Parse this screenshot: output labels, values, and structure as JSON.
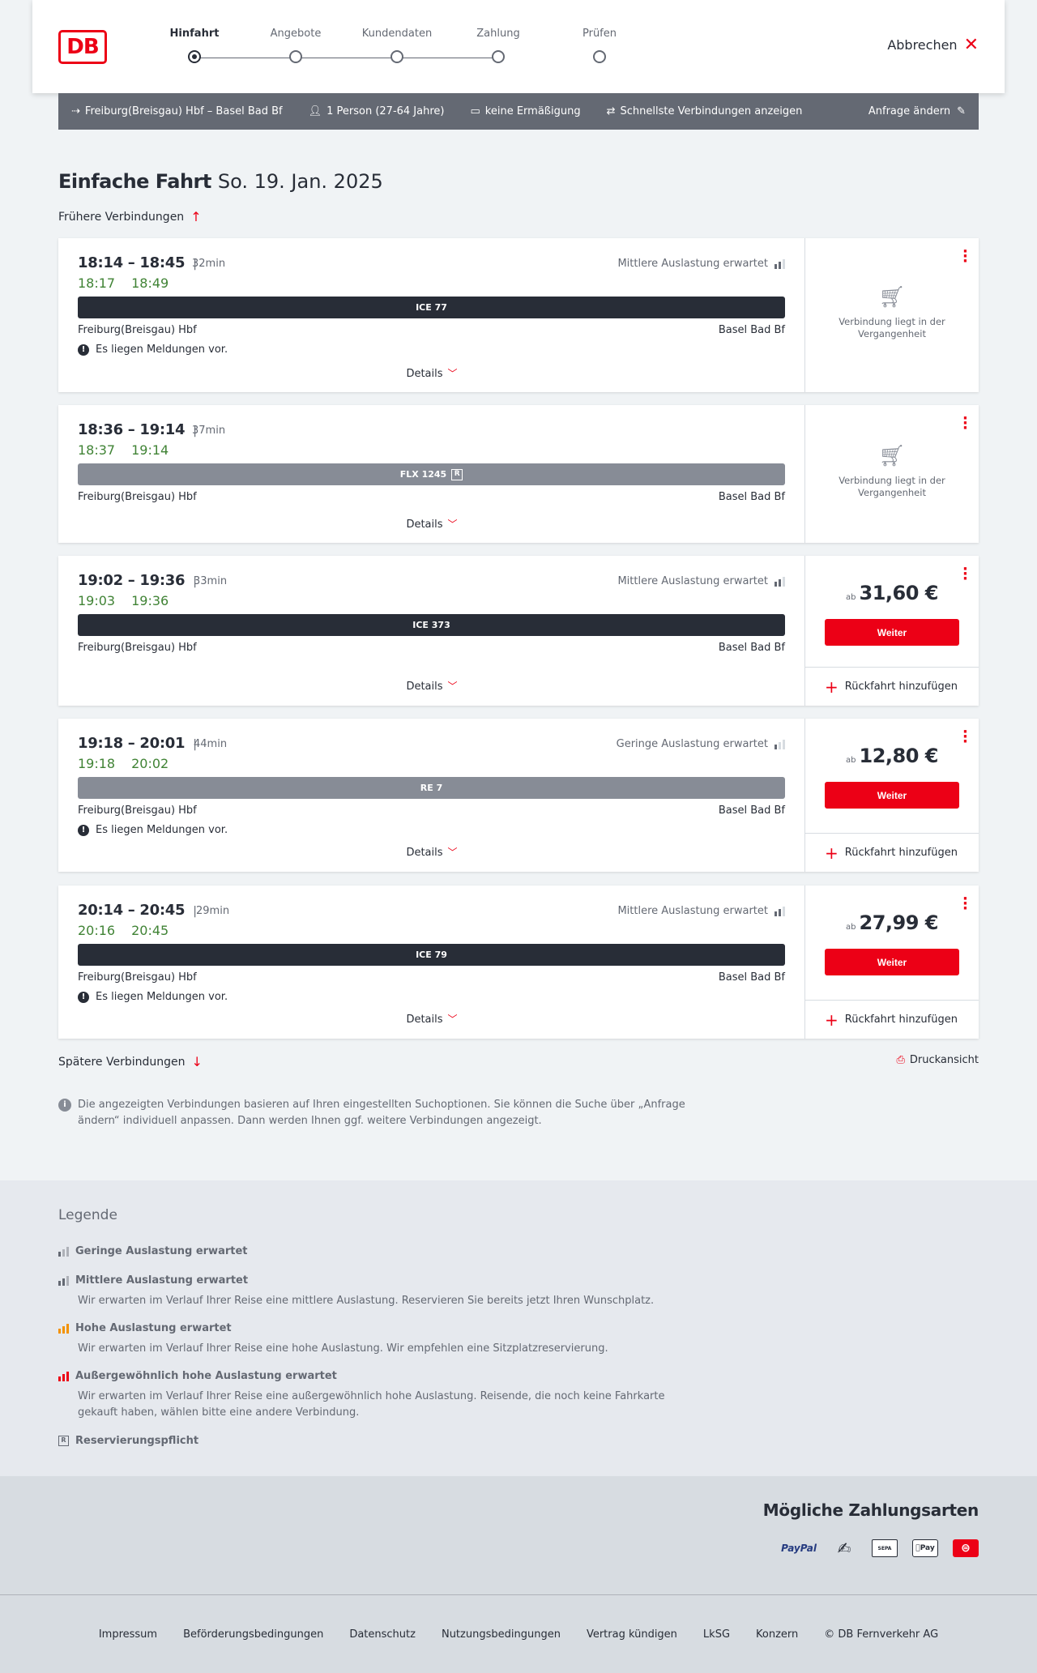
{
  "header": {
    "logo": "DB",
    "steps": [
      {
        "label": "Hinfahrt",
        "active": true
      },
      {
        "label": "Angebote",
        "active": false
      },
      {
        "label": "Kundendaten",
        "active": false
      },
      {
        "label": "Zahlung",
        "active": false
      },
      {
        "label": "Prüfen",
        "active": false
      }
    ],
    "cancel_label": "Abbrechen"
  },
  "query": {
    "route": "Freiburg(Breisgau) Hbf – Basel Bad Bf",
    "persons": "1 Person (27-64 Jahre)",
    "discount": "keine Ermäßigung",
    "fastest": "Schnellste Verbindungen anzeigen",
    "change": "Anfrage ändern"
  },
  "page": {
    "title": "Einfache Fahrt",
    "date": "So. 19. Jan. 2025",
    "earlier": "Frühere Verbindungen",
    "later": "Spätere Verbindungen",
    "print": "Druckansicht",
    "info": "Die angezeigten Verbindungen basieren auf Ihren eingestellten Suchoptionen. Sie können die Suche über „Anfrage ändern“ individuell anpassen. Dann werden Ihnen ggf. weitere Verbindungen angezeigt."
  },
  "common": {
    "details": "Details",
    "from": "Freiburg(Breisgau) Hbf",
    "to": "Basel Bad Bf",
    "messages": "Es liegen Meldungen vor.",
    "past": "Verbindung liegt in der Vergangenheit",
    "price_prefix": "ab",
    "weiter": "Weiter",
    "return": "Rückfahrt hinzufügen"
  },
  "connections": [
    {
      "times": "18:14 – 18:45",
      "duration": "32min",
      "rt_dep": "18:17",
      "rt_arr": "18:49",
      "load": "Mittlere Auslastung erwartet",
      "load_level": 2,
      "train": "ICE 77",
      "train_style": "dark",
      "reservation": false,
      "messages": true,
      "past": true,
      "price": ""
    },
    {
      "times": "18:36 – 19:14",
      "duration": "37min",
      "rt_dep": "18:37",
      "rt_arr": "19:14",
      "load": "",
      "load_level": 0,
      "train": "FLX 1245",
      "train_style": "grey",
      "reservation": true,
      "messages": false,
      "past": true,
      "price": ""
    },
    {
      "times": "19:02 – 19:36",
      "duration": "33min",
      "rt_dep": "19:03",
      "rt_arr": "19:36",
      "load": "Mittlere Auslastung erwartet",
      "load_level": 2,
      "train": "ICE 373",
      "train_style": "dark",
      "reservation": false,
      "messages": false,
      "past": false,
      "price": "31,60 €"
    },
    {
      "times": "19:18 – 20:01",
      "duration": "44min",
      "rt_dep": "19:18",
      "rt_arr": "20:02",
      "load": "Geringe Auslastung erwartet",
      "load_level": 1,
      "train": "RE 7",
      "train_style": "grey",
      "reservation": false,
      "messages": true,
      "past": false,
      "price": "12,80 €"
    },
    {
      "times": "20:14 – 20:45",
      "duration": "29min",
      "rt_dep": "20:16",
      "rt_arr": "20:45",
      "load": "Mittlere Auslastung erwartet",
      "load_level": 2,
      "train": "ICE 79",
      "train_style": "dark",
      "reservation": false,
      "messages": true,
      "past": false,
      "price": "27,99 €"
    }
  ],
  "legend": {
    "title": "Legende",
    "items": [
      {
        "title": "Geringe Auslastung erwartet",
        "desc": ""
      },
      {
        "title": "Mittlere Auslastung erwartet",
        "desc": "Wir erwarten im Verlauf Ihrer Reise eine mittlere Auslastung. Reservieren Sie bereits jetzt Ihren Wunschplatz."
      },
      {
        "title": "Hohe Auslastung erwartet",
        "desc": "Wir erwarten im Verlauf Ihrer Reise eine hohe Auslastung. Wir empfehlen eine Sitzplatzreservierung."
      },
      {
        "title": "Außergewöhnlich hohe Auslastung erwartet",
        "desc": "Wir erwarten im Verlauf Ihrer Reise eine außergewöhnlich hohe Auslastung. Reisende, die noch keine Fahrkarte gekauft haben, wählen bitte eine andere Verbindung."
      },
      {
        "title": "Reservierungspflicht",
        "desc": ""
      }
    ]
  },
  "payment": {
    "title": "Mögliche Zahlungsarten",
    "methods": [
      "PayPal",
      "SEPA",
      "Pay"
    ]
  },
  "footer": {
    "links": [
      "Impressum",
      "Beförderungsbedingungen",
      "Datenschutz",
      "Nutzungsbedingungen",
      "Vertrag kündigen",
      "LkSG",
      "Konzern",
      "© DB Fernverkehr AG"
    ]
  },
  "colors": {
    "accent": "#ec0016",
    "realtime": "#408335",
    "querybar": "#646973",
    "dark_train": "#282d37",
    "grey_train": "#878c96"
  }
}
